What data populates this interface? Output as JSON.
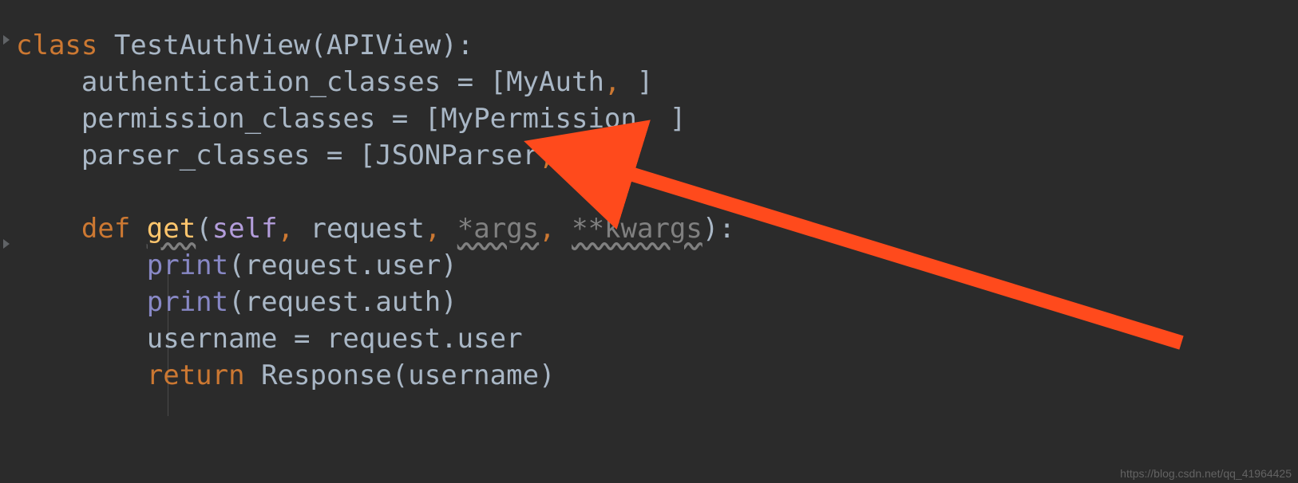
{
  "code": {
    "kw_class": "class",
    "class_name": " TestAuthView(APIView):",
    "line2a": "    authentication_classes = [MyAuth",
    "comma": ",",
    "line2b": " ]",
    "line3a": "    permission_classes = [MyPermission",
    "line3b": " ]",
    "line4a": "    parser_classes = [JSONParser",
    "line4b": " ]",
    "blank": "",
    "kw_def": "    def",
    "fn_get": "get",
    "lparen": "(",
    "self": "self",
    "sep1": ", ",
    "arg_request": "request",
    "sep2": ", ",
    "arg_args": "*args",
    "sep3": ", ",
    "arg_kwargs": "**kwargs",
    "rparen_colon": "):",
    "print1a": "        ",
    "print_fn": "print",
    "print1b": "(request.user)",
    "print2b": "(request.auth)",
    "line_user": "        username = request.user",
    "kw_return_indent": "        ",
    "kw_return": "return",
    "return_rest": " Response(username)"
  },
  "watermark": "https://blog.csdn.net/qq_41964425"
}
